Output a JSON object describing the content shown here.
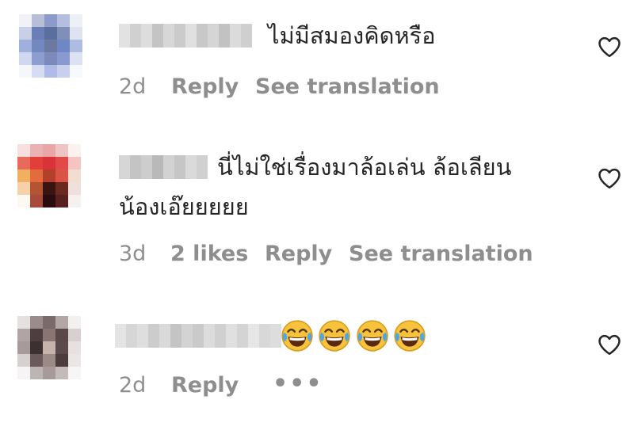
{
  "comments": [
    {
      "text": "ไม่มีสมองคิดหรือ",
      "time": "2d",
      "reply_label": "Reply",
      "translate_label": "See translation"
    },
    {
      "text_line1": "นี่ไม่ใช่เรื่องมาล้อเล่น ล้อเลียน",
      "text_line2": "น้องเอ๊ยยยยย",
      "time": "3d",
      "likes": "2 likes",
      "reply_label": "Reply",
      "translate_label": "See translation"
    },
    {
      "emoji": "😂😂😂😂",
      "time": "2d",
      "reply_label": "Reply",
      "more_label": "•••"
    }
  ],
  "icons": {
    "like": "heart-outline-icon",
    "more": "more-horizontal-icon",
    "emoji": "face-with-tears-of-joy"
  },
  "colors": {
    "text": "#262626",
    "secondary": "#8e8e8e",
    "background": "#ffffff"
  }
}
